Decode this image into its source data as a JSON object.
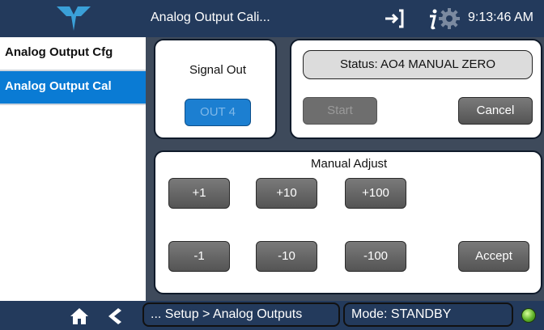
{
  "header": {
    "title": "Analog Output Cali...",
    "time": "9:13:46 AM"
  },
  "sidebar": {
    "items": [
      {
        "label": "Analog Output Cfg"
      },
      {
        "label": "Analog Output Cal"
      }
    ]
  },
  "signal": {
    "label": "Signal Out",
    "output_button": "OUT 4"
  },
  "status": {
    "text": "Status:  AO4 MANUAL ZERO",
    "start_label": "Start",
    "cancel_label": "Cancel"
  },
  "manual": {
    "title": "Manual Adjust",
    "plus": [
      "+1",
      "+10",
      "+100"
    ],
    "minus": [
      "-1",
      "-10",
      "-100"
    ],
    "accept_label": "Accept"
  },
  "footer": {
    "breadcrumb": "... Setup > Analog Outputs",
    "mode": "Mode: STANDBY"
  },
  "colors": {
    "accent": "#0a7bd4",
    "header": "#233a5c",
    "status_led": "#5fb32a"
  }
}
